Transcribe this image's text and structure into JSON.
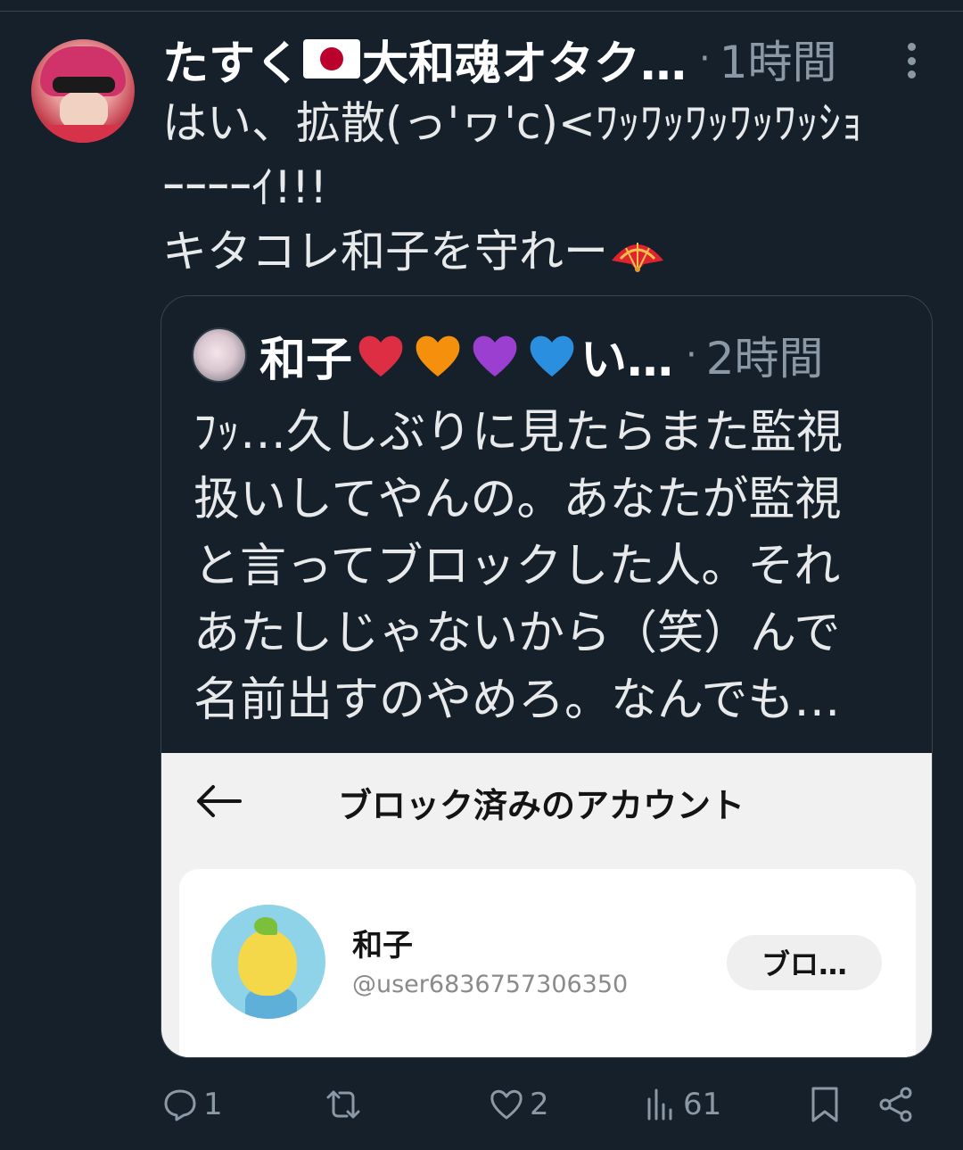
{
  "tweet": {
    "display_name_part1": "たすく",
    "display_name_part2": "大和魂オタク…",
    "separator": "·",
    "timestamp": "1時間",
    "text_lines": [
      "はい、拡散(っ'ヮ'c)<ﾜｯﾜｯﾜｯﾜｯﾜｯｼｮ",
      "ｰｰｰｰｲ!!!",
      "キタコレ和子を守れー"
    ]
  },
  "quote": {
    "name_part1": "和子",
    "name_part2": "い…",
    "separator": "·",
    "timestamp": "2時間",
    "text_lines": [
      "ﾌｯ…久しぶりに見たらまた監視",
      "扱いしてやんの。あなたが監視",
      "と言ってブロックした人。それ",
      "あたしじゃないから（笑）んで",
      "名前出すのやめろ。なんでも…"
    ],
    "embedded_screenshot": {
      "title": "ブロック済みのアカウント",
      "blocked_account": {
        "name": "和子",
        "handle": "@user6836757306350",
        "button_label": "ブロ…"
      }
    }
  },
  "actions": {
    "reply_count": "1",
    "like_count": "2",
    "views_count": "61"
  },
  "colors": {
    "background": "#15202b",
    "secondary_text": "#8b98a5",
    "border": "#38444d"
  }
}
